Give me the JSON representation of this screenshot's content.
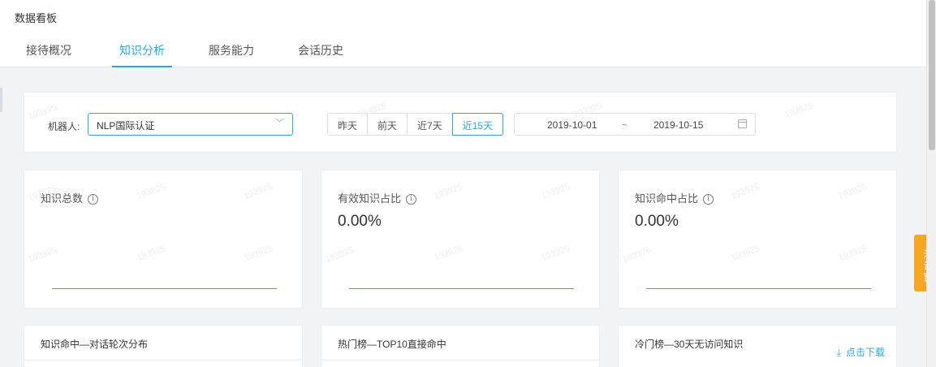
{
  "page": {
    "title": "数据看板"
  },
  "tabs": [
    {
      "label": "接待概况",
      "active": false
    },
    {
      "label": "知识分析",
      "active": true
    },
    {
      "label": "服务能力",
      "active": false
    },
    {
      "label": "会话历史",
      "active": false
    }
  ],
  "filter": {
    "robot_label": "机器人:",
    "robot_value": "NLP国际认证",
    "ranges": [
      "昨天",
      "前天",
      "近7天",
      "近15天"
    ],
    "active_range": "近15天",
    "date_start": "2019-10-01",
    "date_separator": "~",
    "date_end": "2019-10-15"
  },
  "stats": [
    {
      "title": "知识总数",
      "value": ""
    },
    {
      "title": "有效知识占比",
      "value": "0.00%"
    },
    {
      "title": "知识命中占比",
      "value": "0.00%"
    }
  ],
  "panels": [
    {
      "title": "知识命中—对话轮次分布"
    },
    {
      "title": "热门榜—TOP10直接命中"
    },
    {
      "title": "冷门榜—30天无访问知识",
      "action": "点击下载"
    }
  ],
  "test_window": {
    "label": "测试窗"
  },
  "watermark": "193925",
  "colors": {
    "accent": "#29a9e0",
    "test_window": "#f5a623"
  }
}
